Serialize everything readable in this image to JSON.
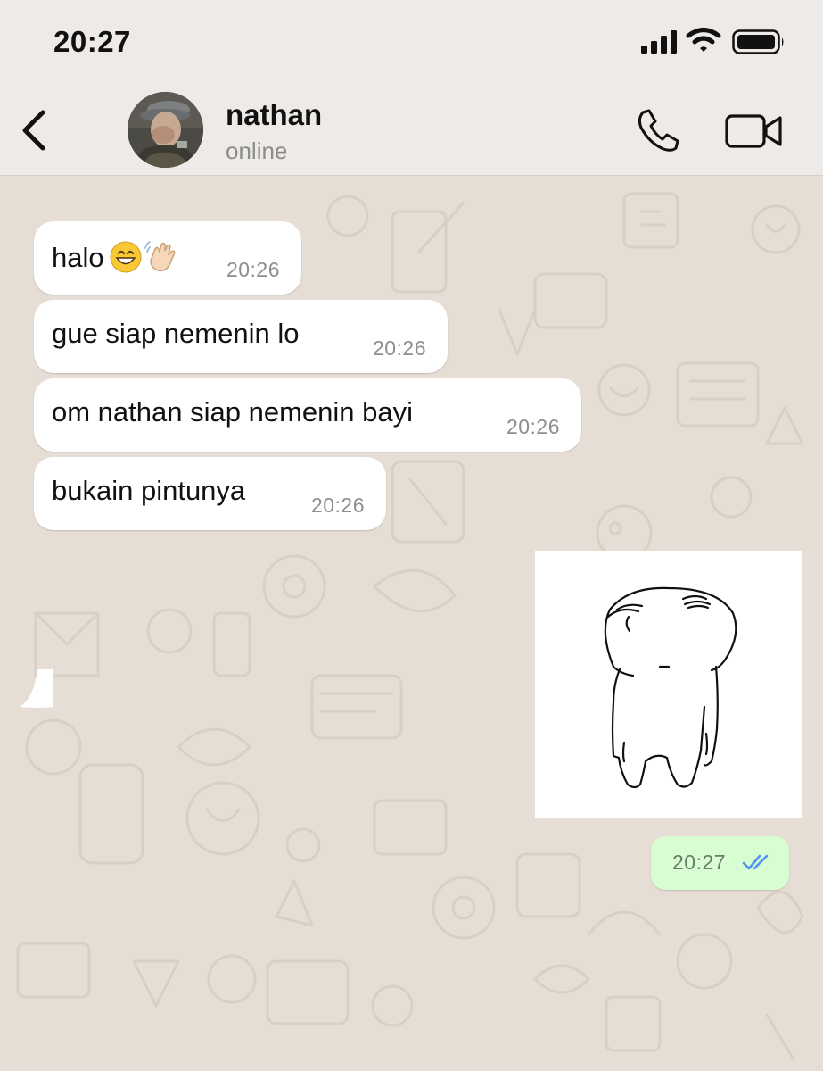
{
  "status_bar": {
    "time": "20:27",
    "icons": [
      "signal-icon",
      "wifi-icon",
      "battery-icon"
    ]
  },
  "header": {
    "back_icon": "chevron-left-icon",
    "contact_name": "nathan",
    "contact_status": "online",
    "actions": [
      "phone-icon",
      "video-camera-icon"
    ]
  },
  "messages": [
    {
      "direction": "incoming",
      "text": "halo",
      "emoji": [
        "grinning-face-icon",
        "waving-hand-icon"
      ],
      "time": "20:26"
    },
    {
      "direction": "incoming",
      "text": "gue siap nemenin lo",
      "time": "20:26"
    },
    {
      "direction": "incoming",
      "text": "om nathan siap nemenin bayi",
      "time": "20:26"
    },
    {
      "direction": "incoming",
      "text": "bukain pintunya",
      "time": "20:26"
    },
    {
      "direction": "outgoing",
      "type": "sticker",
      "sticker": "doodle-character-sticker",
      "time": "20:27",
      "status": "read",
      "status_icon": "double-check-icon"
    }
  ],
  "colors": {
    "header_bg": "#edeae7",
    "chat_bg": "#e6ded5",
    "incoming_bubble": "#ffffff",
    "outgoing_bubble": "#d9fdd3",
    "read_ticks": "#4f8ff7"
  }
}
